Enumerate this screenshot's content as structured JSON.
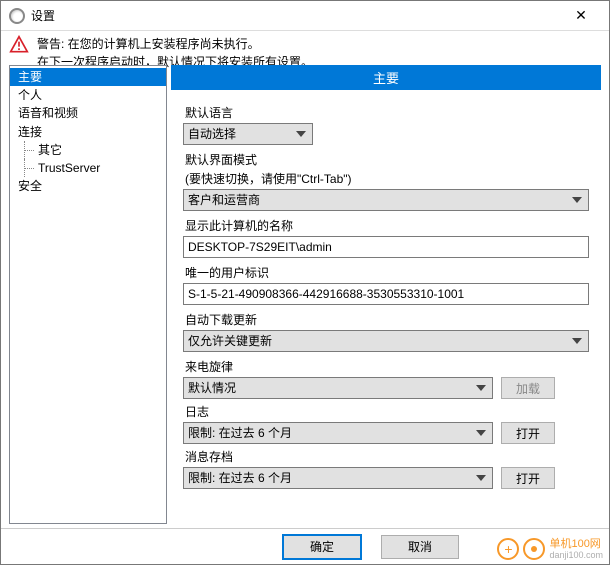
{
  "window": {
    "title": "设置",
    "close": "✕"
  },
  "warning": {
    "line1": "警告: 在您的计算机上安装程序尚未执行。",
    "line2": "在下一次程序启动时，默认情况下将安装所有设置。"
  },
  "nav": {
    "items": [
      {
        "label": "主要",
        "selected": true
      },
      {
        "label": "个人"
      },
      {
        "label": "语音和视频"
      },
      {
        "label": "连接"
      },
      {
        "label": "其它",
        "sub": true
      },
      {
        "label": "TrustServer",
        "sub": true
      },
      {
        "label": "安全"
      }
    ]
  },
  "section": {
    "title": "主要"
  },
  "fields": {
    "default_lang": {
      "label": "默认语言",
      "value": "自动选择"
    },
    "ui_mode": {
      "label": "默认界面模式",
      "hint": "(要快速切换，请使用\"Ctrl-Tab\")",
      "value": "客户和运营商"
    },
    "computer_name": {
      "label": "显示此计算机的名称",
      "value": "DESKTOP-7S29EIT\\admin"
    },
    "user_id": {
      "label": "唯一的用户标识",
      "value": "S-1-5-21-490908366-442916688-3530553310-1001"
    },
    "auto_update": {
      "label": "自动下载更新",
      "value": "仅允许关键更新"
    },
    "ringtone": {
      "label": "来电旋律",
      "value": "默认情况",
      "button": "加载"
    },
    "log": {
      "label": "日志",
      "value": "限制: 在过去 6 个月",
      "button": "打开"
    },
    "msg_archive": {
      "label": "消息存档",
      "value": "限制: 在过去 6 个月",
      "button": "打开"
    }
  },
  "buttons": {
    "ok": "确定",
    "cancel": "取消"
  },
  "watermark": {
    "brand": "单机100网",
    "url": "danji100.com"
  }
}
